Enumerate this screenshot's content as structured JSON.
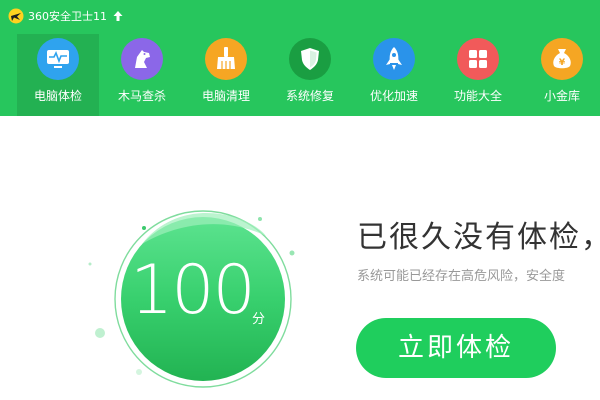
{
  "app": {
    "title": "360安全卫士11"
  },
  "nav": {
    "items": [
      {
        "label": "电脑体检",
        "icon": "monitor-pulse-icon",
        "color": "#2fa3ee",
        "active": true
      },
      {
        "label": "木马查杀",
        "icon": "horse-icon",
        "color": "#8b67e8",
        "active": false
      },
      {
        "label": "电脑清理",
        "icon": "broom-icon",
        "color": "#f6a623",
        "active": false
      },
      {
        "label": "系统修复",
        "icon": "shield-icon",
        "color": "#1a9e42",
        "active": false
      },
      {
        "label": "优化加速",
        "icon": "rocket-icon",
        "color": "#2a93ea",
        "active": false
      },
      {
        "label": "功能大全",
        "icon": "grid-icon",
        "color": "#f15a5a",
        "active": false
      },
      {
        "label": "小金库",
        "icon": "money-bag-icon",
        "color": "#f5a623",
        "active": false
      }
    ]
  },
  "main": {
    "score": "100",
    "score_unit": "分",
    "headline": "已很久没有体检，建",
    "subline": "系统可能已经存在高危风险，安全度",
    "check_button": "立即体检"
  },
  "colors": {
    "header": "#27c65d",
    "accent": "#1fce5d"
  }
}
